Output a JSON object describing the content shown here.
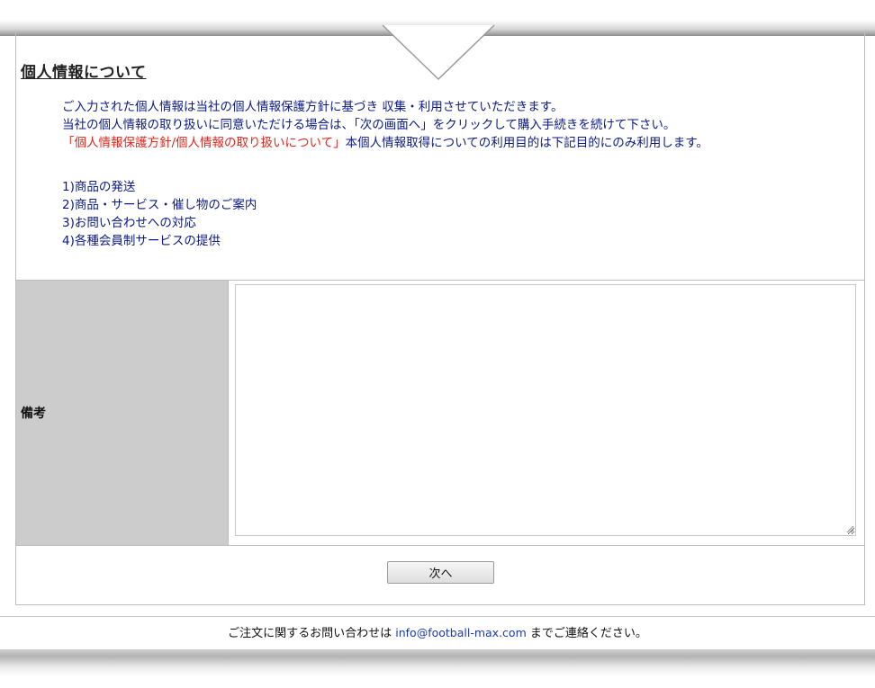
{
  "privacy": {
    "title": "個人情報について",
    "line1": "ご入力された個人情報は当社の個人情報保護方針に基づき 収集・利用させていただきます。",
    "line2": "当社の個人情報の取り扱いに同意いただける場合は、「次の画面へ」をクリックして購入手続きを続けて下さい。",
    "line3_link": "「個人情報保護方針/個人情報の取り扱いについて」",
    "line3_rest": "本個人情報取得についての利用目的は下記目的にのみ利用します。",
    "purposes": [
      "1)商品の発送",
      "2)商品・サービス・催し物のご案内",
      "3)お問い合わせへの対応",
      "4)各種会員制サービスの提供"
    ]
  },
  "note": {
    "label": "備考",
    "value": ""
  },
  "actions": {
    "next_label": "次へ"
  },
  "footer": {
    "prefix": "ご注文に関するお問い合わせは ",
    "email": "info@football-max.com",
    "suffix": " までご連絡ください。"
  },
  "colors": {
    "body_text": "#0b1a86",
    "highlight_red": "#e2261c",
    "label_cell_bg": "#cccccc",
    "link_blue": "#1a3ab8"
  }
}
